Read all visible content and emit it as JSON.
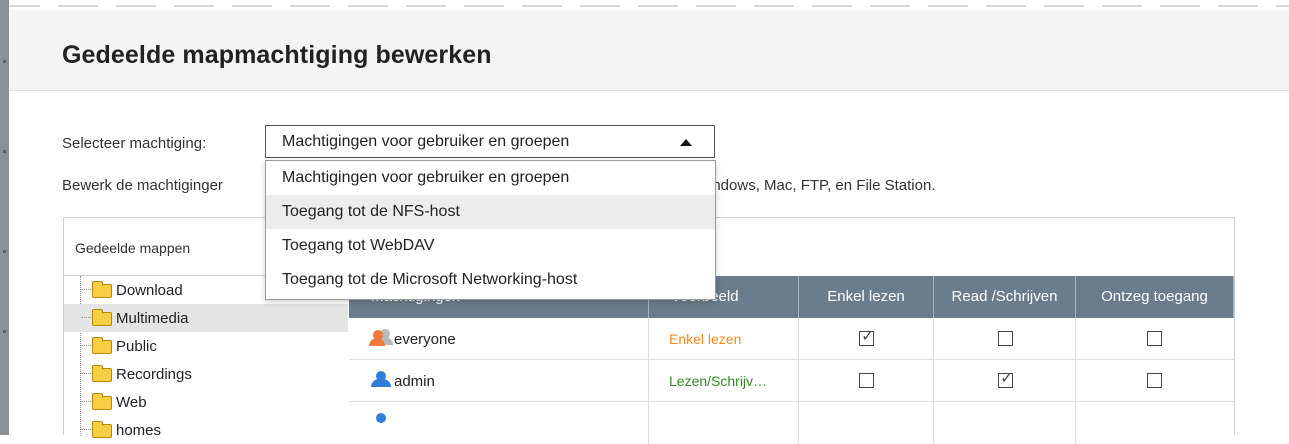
{
  "dialog": {
    "title": "Gedeelde mapmachtiging bewerken",
    "select_label": "Selecteer machtiging:",
    "select_value": "Machtigingen voor gebruiker en groepen",
    "description_start": "Bewerk de machtiginger",
    "description_end": "indows, Mac, FTP, en File Station.",
    "dropdown_options": [
      "Machtigingen voor gebruiker en groepen",
      "Toegang tot de NFS-host",
      "Toegang tot WebDAV",
      "Toegang tot de Microsoft Networking-host"
    ],
    "highlighted_option_index": 1
  },
  "tree": {
    "header": "Gedeelde mappen",
    "folders": [
      "Download",
      "Multimedia",
      "Public",
      "Recordings",
      "Web",
      "homes"
    ],
    "selected_index": 1
  },
  "permissions": {
    "columns": [
      "Machtigingen",
      "Voorbeeld",
      "Enkel lezen",
      "Read /Schrijven",
      "Ontzeg toegang"
    ],
    "rows": [
      {
        "name": "everyone",
        "example": "Enkel lezen",
        "example_color": "#f08a1c",
        "icon": "group-user-icon",
        "read_only": true,
        "read_write": false,
        "deny": false
      },
      {
        "name": "admin",
        "example": "Lezen/Schrijv…",
        "example_color": "#2e8b1e",
        "icon": "user-icon",
        "read_only": false,
        "read_write": true,
        "deny": false
      }
    ]
  },
  "colors": {
    "header_bar": "#f4f4f4",
    "table_header": "#6b7c8c",
    "selection": "#e4e4e4",
    "folder": "#f6cf43"
  }
}
